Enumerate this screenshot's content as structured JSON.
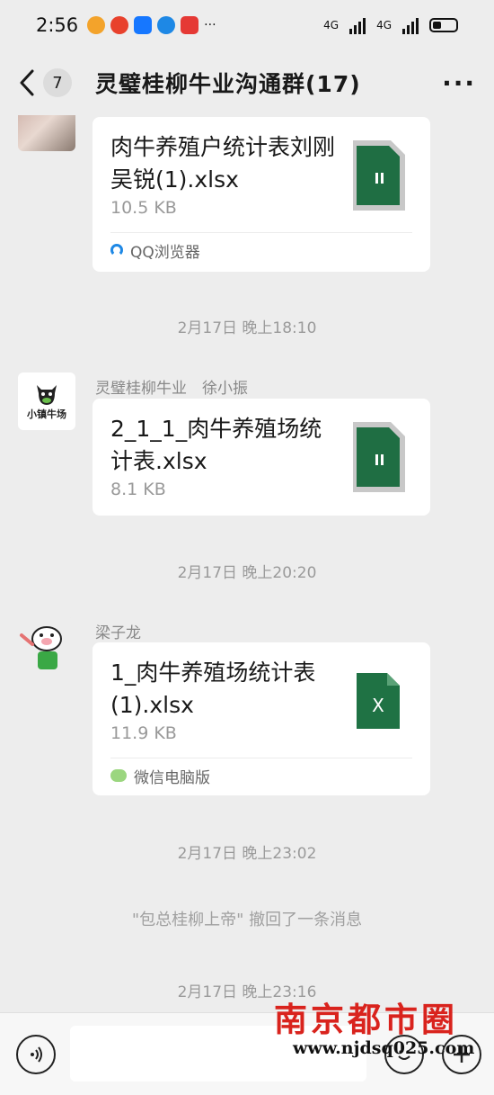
{
  "status_bar": {
    "time": "2:56",
    "network1": "4G",
    "network2": "4G"
  },
  "header": {
    "back_count": "7",
    "title": "灵璧桂柳牛业沟通群(17)",
    "more": "···"
  },
  "messages": {
    "m1": {
      "file_name": "肉牛养殖户统计表刘刚吴锐(1).xlsx",
      "file_size": "10.5 KB",
      "source": "QQ浏览器"
    },
    "t1": "2月17日 晚上18:10",
    "m2": {
      "avatar_text": "小镇牛场",
      "sender": "灵璧桂柳牛业　徐小振",
      "file_name": "2_1_1_肉牛养殖场统计表.xlsx",
      "file_size": "8.1 KB"
    },
    "t2": "2月17日 晚上20:20",
    "m3": {
      "sender": "梁子龙",
      "file_name": "1_肉牛养殖场统计表(1).xlsx",
      "file_size": "11.9 KB",
      "source": "微信电脑版",
      "icon_letter": "X"
    },
    "t3": "2月17日 晚上23:02",
    "recall": "\"包总桂柳上帝\" 撤回了一条消息",
    "t4": "2月17日 晚上23:16"
  },
  "watermark": {
    "name": "南京都市圈",
    "url": "www.njdsq025.com"
  },
  "colors": {
    "excel_green": "#1f6e43",
    "background": "#ededed",
    "watermark_red": "#d9231d"
  }
}
